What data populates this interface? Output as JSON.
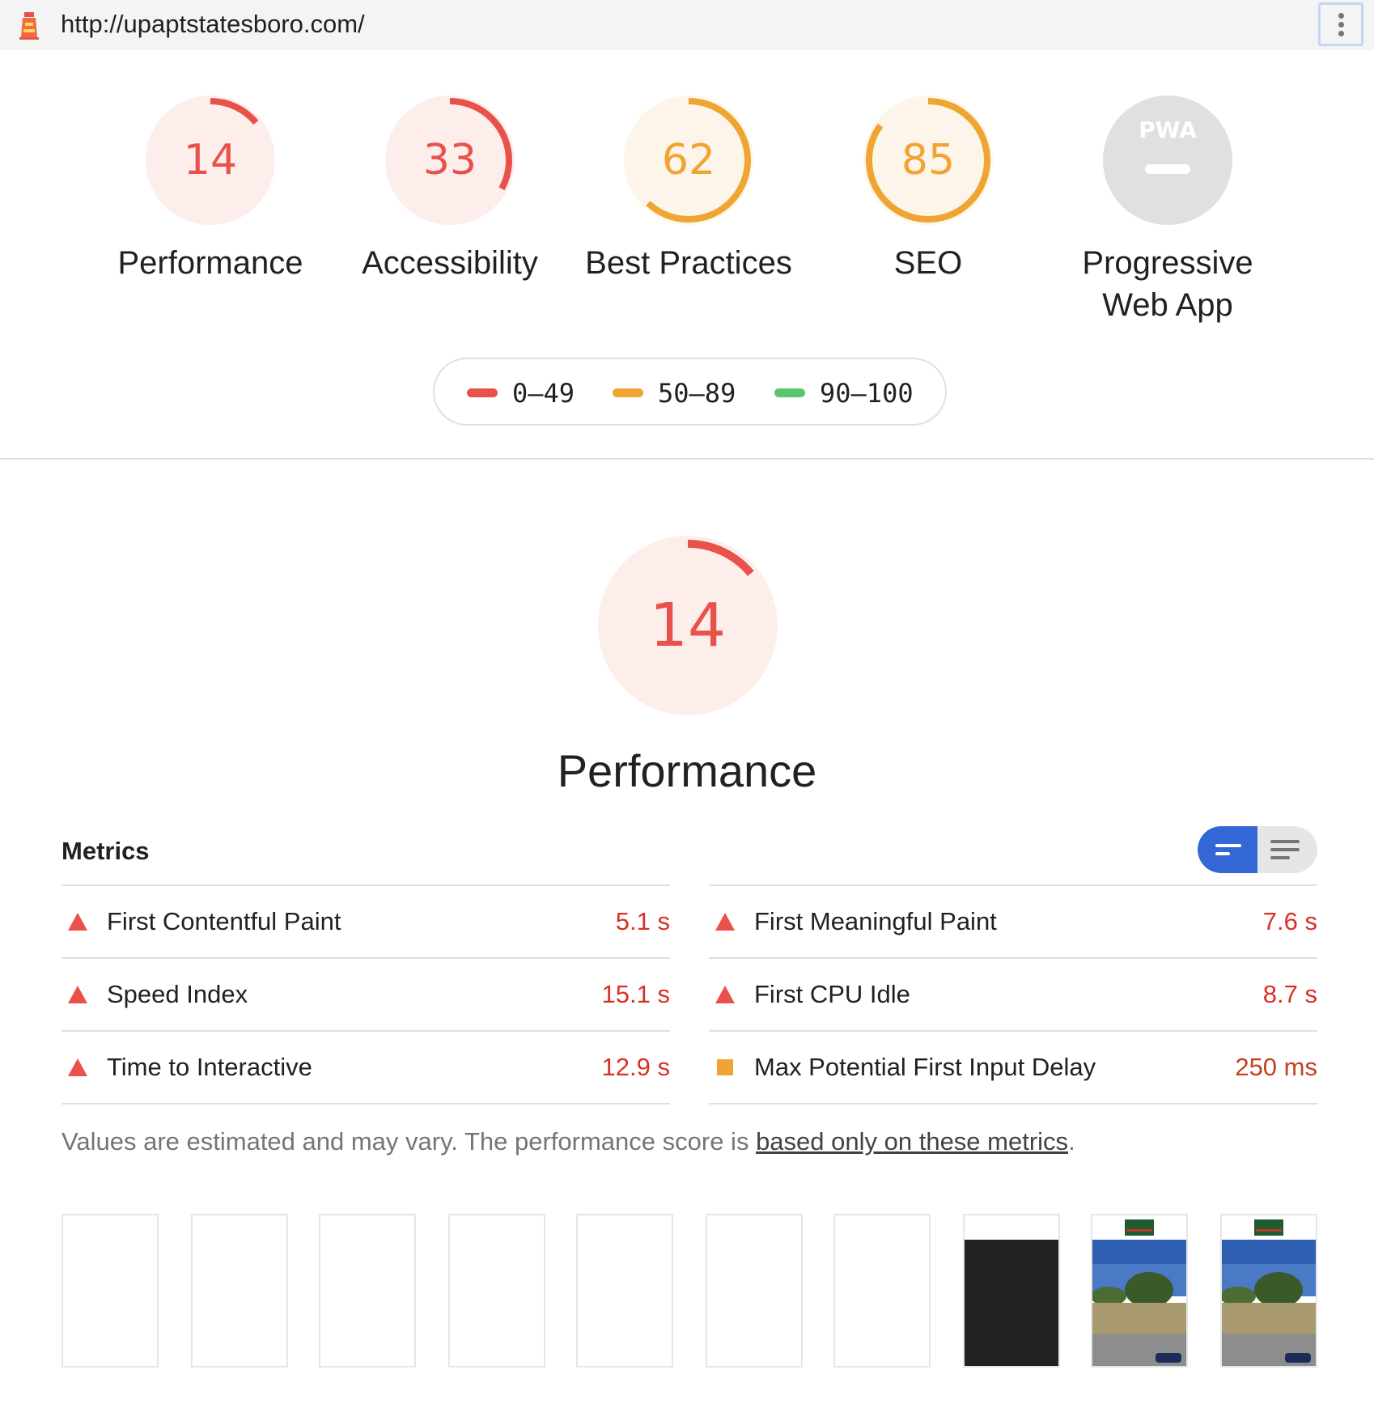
{
  "browser": {
    "url": "http://upaptstatesboro.com/",
    "logo_icon": "lighthouse-icon",
    "menu_icon": "kebab-menu-icon"
  },
  "colors": {
    "fail": "#e8524a",
    "average": "#f0a431",
    "pass": "#5bc56e",
    "fail_bg": "#fdeeec",
    "average_bg": "#fef5ea",
    "pwa_bg": "#e0e0e0",
    "accent": "#3367d6"
  },
  "categories": [
    {
      "score": "14",
      "label": "Performance",
      "fraction": 0.14,
      "rating": "fail"
    },
    {
      "score": "33",
      "label": "Accessibility",
      "fraction": 0.33,
      "rating": "fail"
    },
    {
      "score": "62",
      "label": "Best Practices",
      "fraction": 0.62,
      "rating": "average"
    },
    {
      "score": "85",
      "label": "SEO",
      "fraction": 0.85,
      "rating": "average"
    },
    {
      "badge": "PWA",
      "label_line1": "Progressive",
      "label_line2": "Web App",
      "rating": "na"
    }
  ],
  "legend": [
    {
      "range": "0–49",
      "rating": "fail"
    },
    {
      "range": "50–89",
      "rating": "average"
    },
    {
      "range": "90–100",
      "rating": "pass"
    }
  ],
  "performance": {
    "score": "14",
    "fraction": 0.14,
    "title": "Performance"
  },
  "metrics": {
    "title": "Metrics",
    "left": [
      {
        "name": "First Contentful Paint",
        "value": "5.1 s",
        "rating": "fail"
      },
      {
        "name": "Speed Index",
        "value": "15.1 s",
        "rating": "fail"
      },
      {
        "name": "Time to Interactive",
        "value": "12.9 s",
        "rating": "fail"
      }
    ],
    "right": [
      {
        "name": "First Meaningful Paint",
        "value": "7.6 s",
        "rating": "fail"
      },
      {
        "name": "First CPU Idle",
        "value": "8.7 s",
        "rating": "fail"
      },
      {
        "name": "Max Potential First Input Delay",
        "value": "250 ms",
        "rating": "average"
      }
    ],
    "toggle_compact_icon": "compact-view-icon",
    "toggle_expanded_icon": "expanded-view-icon"
  },
  "note": {
    "prefix": "Values are estimated and may vary. The performance score is ",
    "link": "based only on these metrics",
    "suffix": "."
  },
  "filmstrip": {
    "frames": [
      "blank",
      "blank",
      "blank",
      "blank",
      "blank",
      "blank",
      "blank",
      "dark",
      "photo",
      "photo"
    ]
  }
}
